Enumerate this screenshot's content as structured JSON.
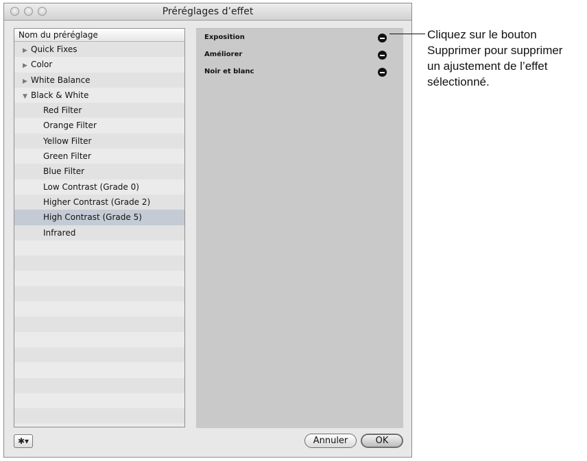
{
  "window": {
    "title": "Préréglages d’effet"
  },
  "preset_list": {
    "header": "Nom du préréglage",
    "items": [
      {
        "label": "Quick Fixes",
        "kind": "group",
        "expanded": false
      },
      {
        "label": "Color",
        "kind": "group",
        "expanded": false
      },
      {
        "label": "White Balance",
        "kind": "group",
        "expanded": false
      },
      {
        "label": "Black & White",
        "kind": "group",
        "expanded": true
      },
      {
        "label": "Red Filter",
        "kind": "child"
      },
      {
        "label": "Orange Filter",
        "kind": "child"
      },
      {
        "label": "Yellow Filter",
        "kind": "child"
      },
      {
        "label": "Green Filter",
        "kind": "child"
      },
      {
        "label": "Blue Filter",
        "kind": "child"
      },
      {
        "label": "Low Contrast (Grade 0)",
        "kind": "child"
      },
      {
        "label": "Higher Contrast (Grade 2)",
        "kind": "child"
      },
      {
        "label": "High Contrast (Grade 5)",
        "kind": "child",
        "selected": true
      },
      {
        "label": "Infrared",
        "kind": "child"
      }
    ]
  },
  "adjustments": [
    {
      "label": "Exposition"
    },
    {
      "label": "Améliorer"
    },
    {
      "label": "Noir et blanc"
    }
  ],
  "buttons": {
    "gear": "✱▾",
    "cancel": "Annuler",
    "ok": "OK"
  },
  "callout": {
    "text": "Cliquez sur le bouton\nSupprimer pour supprimer\nun ajustement de l’effet\nsélectionné."
  },
  "colors": {
    "selection": "#c5cbd5",
    "panel": "#c9c9c9"
  }
}
